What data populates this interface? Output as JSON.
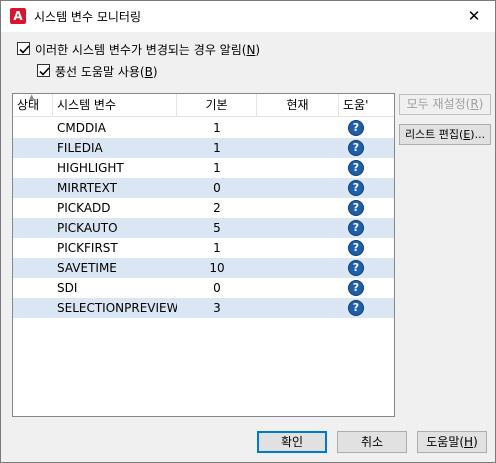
{
  "window": {
    "title": "시스템 변수 모니터링",
    "close_glyph": "✕"
  },
  "options": {
    "notify_label_prefix": "이러한 시스템 변수가 변경되는 경우 알림(",
    "notify_mnemonic": "N",
    "notify_label_suffix": ")",
    "notify_checked": true,
    "balloon_label_prefix": "풍선 도움말 사용(",
    "balloon_mnemonic": "B",
    "balloon_label_suffix": ")",
    "balloon_checked": true
  },
  "grid": {
    "columns": {
      "status": "상태",
      "name": "시스템 변수",
      "default": "기본",
      "current": "현재",
      "help": "도움'"
    },
    "rows": [
      {
        "name": "CMDDIA",
        "default": "1",
        "current": ""
      },
      {
        "name": "FILEDIA",
        "default": "1",
        "current": ""
      },
      {
        "name": "HIGHLIGHT",
        "default": "1",
        "current": ""
      },
      {
        "name": "MIRRTEXT",
        "default": "0",
        "current": ""
      },
      {
        "name": "PICKADD",
        "default": "2",
        "current": ""
      },
      {
        "name": "PICKAUTO",
        "default": "5",
        "current": ""
      },
      {
        "name": "PICKFIRST",
        "default": "1",
        "current": ""
      },
      {
        "name": "SAVETIME",
        "default": "10",
        "current": ""
      },
      {
        "name": "SDI",
        "default": "0",
        "current": ""
      },
      {
        "name": "SELECTIONPREVIEW",
        "default": "3",
        "current": ""
      }
    ],
    "help_glyph": "?"
  },
  "side_buttons": {
    "reset_all_prefix": "모두 재설정(",
    "reset_all_mnemonic": "R",
    "reset_all_suffix": ")",
    "edit_list_prefix": "리스트 편집(",
    "edit_list_mnemonic": "E",
    "edit_list_suffix": ")..."
  },
  "footer": {
    "ok": "확인",
    "cancel": "취소",
    "help_prefix": "도움말(",
    "help_mnemonic": "H",
    "help_suffix": ")"
  },
  "colors": {
    "alt_row": "#dbe6f4",
    "app_icon": "#d9142c",
    "help_icon": "#1f5fa8",
    "default_button_border": "#0078d7"
  }
}
